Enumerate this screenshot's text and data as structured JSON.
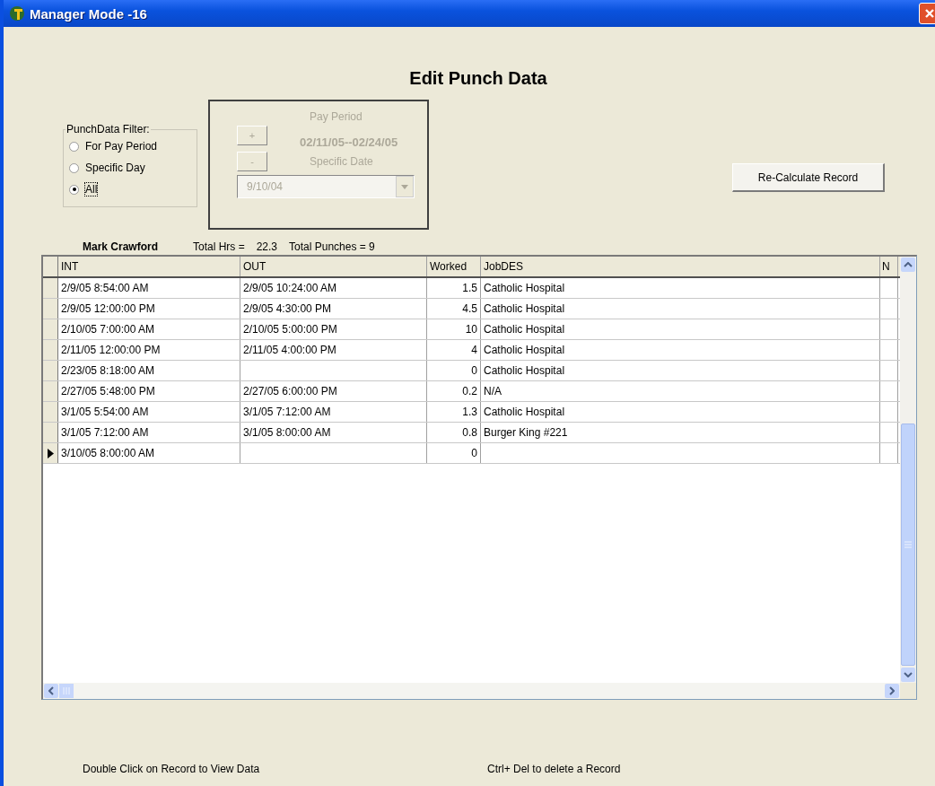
{
  "window": {
    "title": "Manager Mode -16"
  },
  "heading": "Edit Punch Data",
  "filter": {
    "legend": "PunchData Filter:",
    "options": [
      {
        "label": "For Pay Period",
        "selected": false
      },
      {
        "label": "Specific Day",
        "selected": false
      },
      {
        "label": "All",
        "selected": true
      }
    ]
  },
  "pay_period": {
    "disabled": true,
    "plus": "+",
    "minus": "-",
    "label": "Pay Period",
    "range": "02/11/05--02/24/05",
    "date_label": "Specific Date",
    "date_value": "9/10/04"
  },
  "recalc_button": "Re-Calculate Record",
  "summary": {
    "employee": "Mark Crawford",
    "total_hrs_label": "Total Hrs =",
    "total_hrs": "22.3",
    "total_punches": "Total Punches = 9"
  },
  "table": {
    "columns": [
      "INT",
      "OUT",
      "Worked",
      "JobDES",
      "N"
    ],
    "rows": [
      {
        "current": false,
        "cells": [
          "2/9/05 8:54:00 AM",
          "2/9/05 10:24:00 AM",
          "1.5",
          "Catholic Hospital"
        ]
      },
      {
        "current": false,
        "cells": [
          "2/9/05 12:00:00 PM",
          "2/9/05 4:30:00 PM",
          "4.5",
          "Catholic Hospital"
        ]
      },
      {
        "current": false,
        "cells": [
          "2/10/05 7:00:00 AM",
          "2/10/05 5:00:00 PM",
          "10",
          "Catholic Hospital"
        ]
      },
      {
        "current": false,
        "cells": [
          "2/11/05 12:00:00 PM",
          "2/11/05 4:00:00 PM",
          "4",
          "Catholic Hospital"
        ]
      },
      {
        "current": false,
        "cells": [
          "2/23/05 8:18:00 AM",
          "",
          "0",
          "Catholic Hospital"
        ]
      },
      {
        "current": false,
        "cells": [
          "2/27/05 5:48:00 PM",
          "2/27/05 6:00:00 PM",
          "0.2",
          "N/A"
        ]
      },
      {
        "current": false,
        "cells": [
          "3/1/05 5:54:00 AM",
          "3/1/05 7:12:00 AM",
          "1.3",
          "Catholic Hospital"
        ]
      },
      {
        "current": false,
        "cells": [
          "3/1/05 7:12:00 AM",
          "3/1/05 8:00:00 AM",
          "0.8",
          "Burger King #221"
        ]
      },
      {
        "current": true,
        "cells": [
          "3/10/05 8:00:00 AM",
          "",
          "0",
          ""
        ]
      }
    ]
  },
  "footer": [
    "Double Click on Record to View Data",
    "Ctrl+ Del to delete a Record"
  ]
}
